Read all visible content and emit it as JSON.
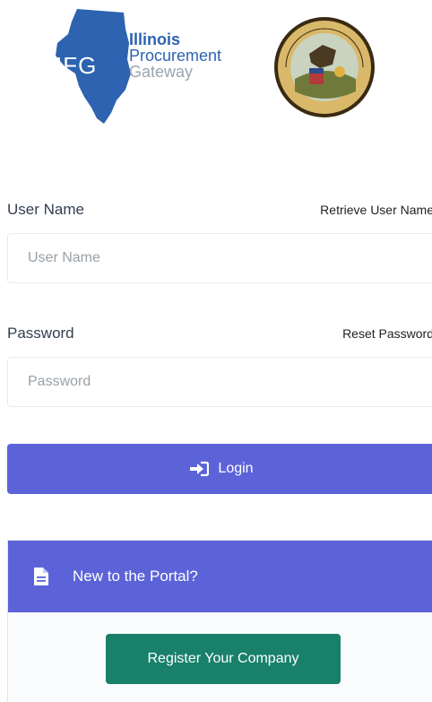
{
  "header": {
    "brand_mark": "IFG",
    "brand_line1": "Illinois",
    "brand_line2": "Procurement",
    "brand_line3": "Gateway",
    "seal_alt": "SEAL OF THE STATE OF ILLINOIS"
  },
  "form": {
    "username_label": "User Name",
    "retrieve_username_link": "Retrieve User Name",
    "username_placeholder": "User Name",
    "password_label": "Password",
    "reset_password_link": "Reset Password",
    "password_placeholder": "Password",
    "login_label": "Login"
  },
  "portal": {
    "heading": "New to the Portal?",
    "register_label": "Register Your Company"
  },
  "colors": {
    "primary": "#5c63d9",
    "success": "#19806b",
    "brand_blue": "#2d63b0"
  }
}
